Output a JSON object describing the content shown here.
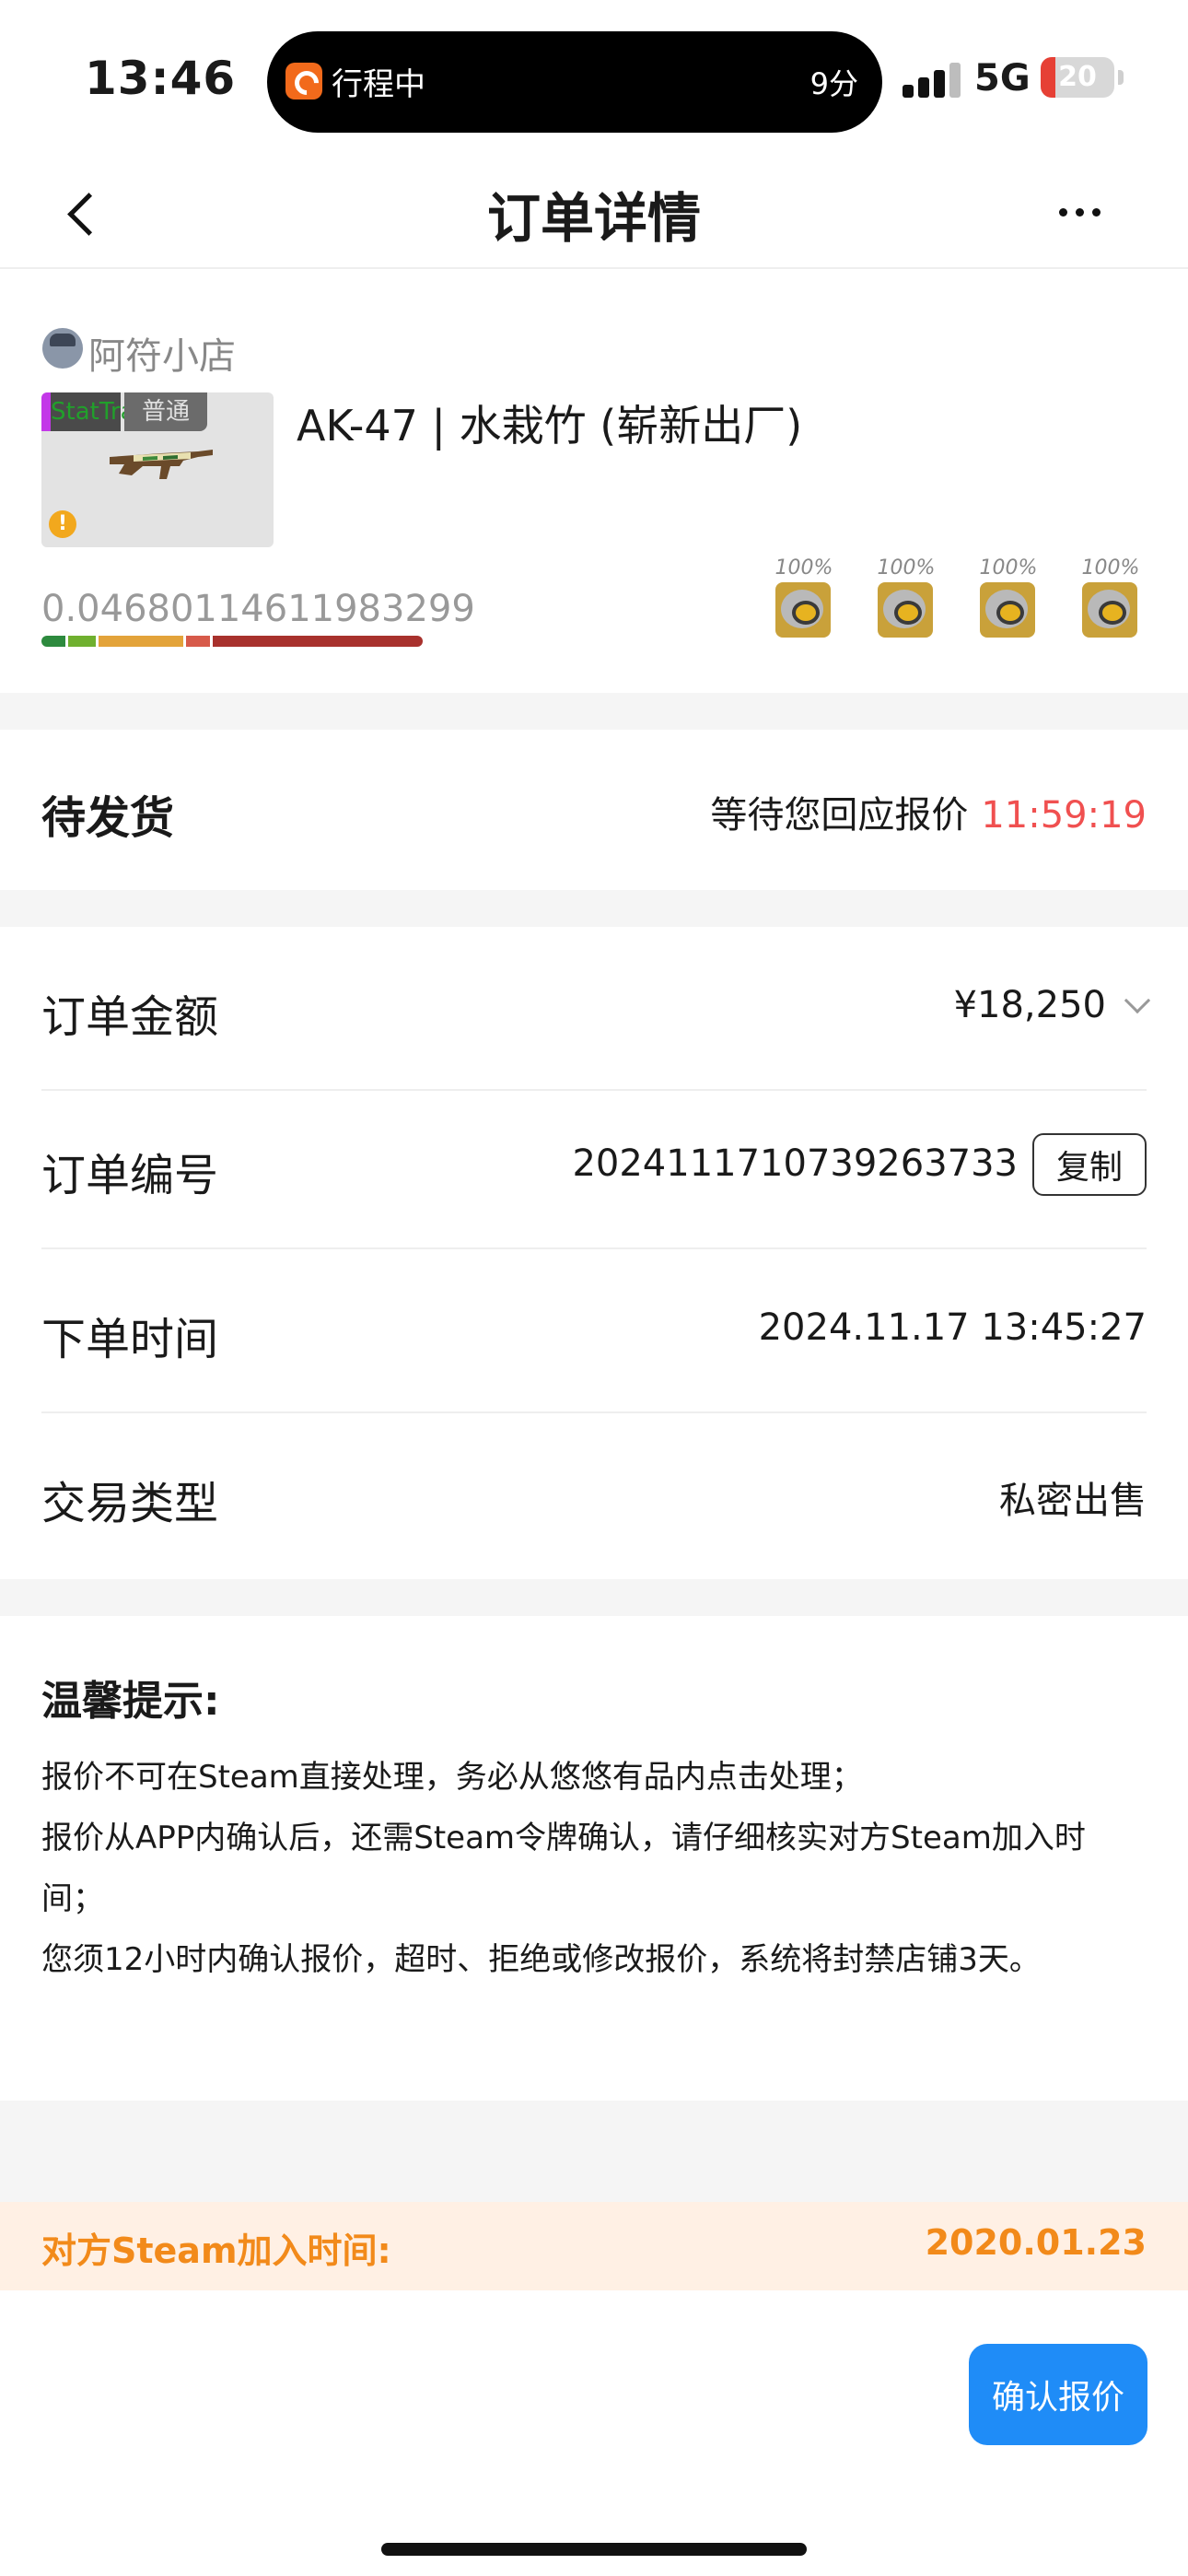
{
  "status_bar": {
    "time": "13:46",
    "activity_label": "行程中",
    "activity_time": "9分",
    "network": "5G",
    "battery": "20",
    "battery_level": 0.2,
    "colors": {
      "battery_low": "#e64035",
      "activity_app": "#f26a1b"
    }
  },
  "navbar": {
    "title": "订单详情",
    "back_icon": "chevron-left-icon",
    "more_icon": "ellipsis-icon"
  },
  "item": {
    "seller_name": "阿符小店",
    "name": "AK-47 | 水栽竹 (崭新出厂)",
    "tag_stattrak": "StatTrak",
    "tag_normal": "普通",
    "float_value": "0.04680114611983299",
    "wear_segments": [
      {
        "color": "#2d8a3e",
        "fraction": 0.07
      },
      {
        "color": "#6fb02f",
        "fraction": 0.08
      },
      {
        "color": "#e3a33a",
        "fraction": 0.23
      },
      {
        "color": "#d75a4a",
        "fraction": 0.07
      },
      {
        "color": "#a8312d",
        "fraction": 0.55
      }
    ],
    "stickers": [
      {
        "wear": "100%",
        "icon": "team-sticker-icon"
      },
      {
        "wear": "100%",
        "icon": "team-sticker-icon"
      },
      {
        "wear": "100%",
        "icon": "team-sticker-icon"
      },
      {
        "wear": "100%",
        "icon": "team-sticker-icon"
      }
    ]
  },
  "order_status": {
    "title": "待发货",
    "description": "等待您回应报价",
    "countdown": "11:59:19",
    "countdown_color": "#f05050"
  },
  "order_info": {
    "amount_label": "订单金额",
    "amount_value": "¥18,250",
    "number_label": "订单编号",
    "number_value": "2024111710739263733",
    "copy_label": "复制",
    "time_label": "下单时间",
    "time_value": "2024.11.17 13:45:27",
    "type_label": "交易类型",
    "type_value": "私密出售"
  },
  "tips": {
    "title": "温馨提示:",
    "lines": [
      "报价不可在Steam直接处理，务必从悠悠有品内点击处理；",
      "报价从APP内确认后，还需Steam令牌确认，请仔细核实对方Steam加入时间；",
      "您须12小时内确认报价，超时、拒绝或修改报价，系统将封禁店铺3天。"
    ]
  },
  "join_info": {
    "label": "对方Steam加入时间:",
    "date": "2020.01.23",
    "color": "#f28a1a"
  },
  "actions": {
    "confirm_label": "确认报价",
    "confirm_color": "#1f8cf7"
  }
}
